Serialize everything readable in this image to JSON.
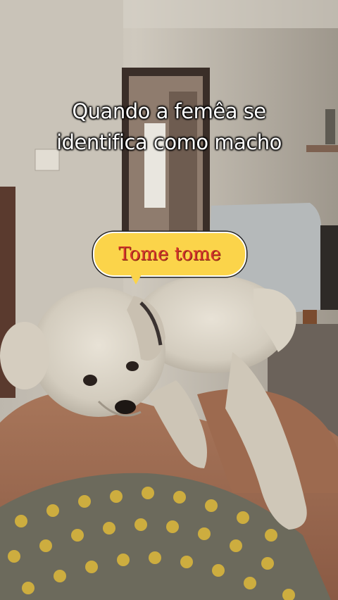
{
  "caption": {
    "line1": "Quando a femêa se",
    "line2": "identifica como macho"
  },
  "bubble": {
    "text": "Tome tome"
  },
  "photo": {
    "subject": "small-white-dog-icon",
    "background": "living-room"
  }
}
